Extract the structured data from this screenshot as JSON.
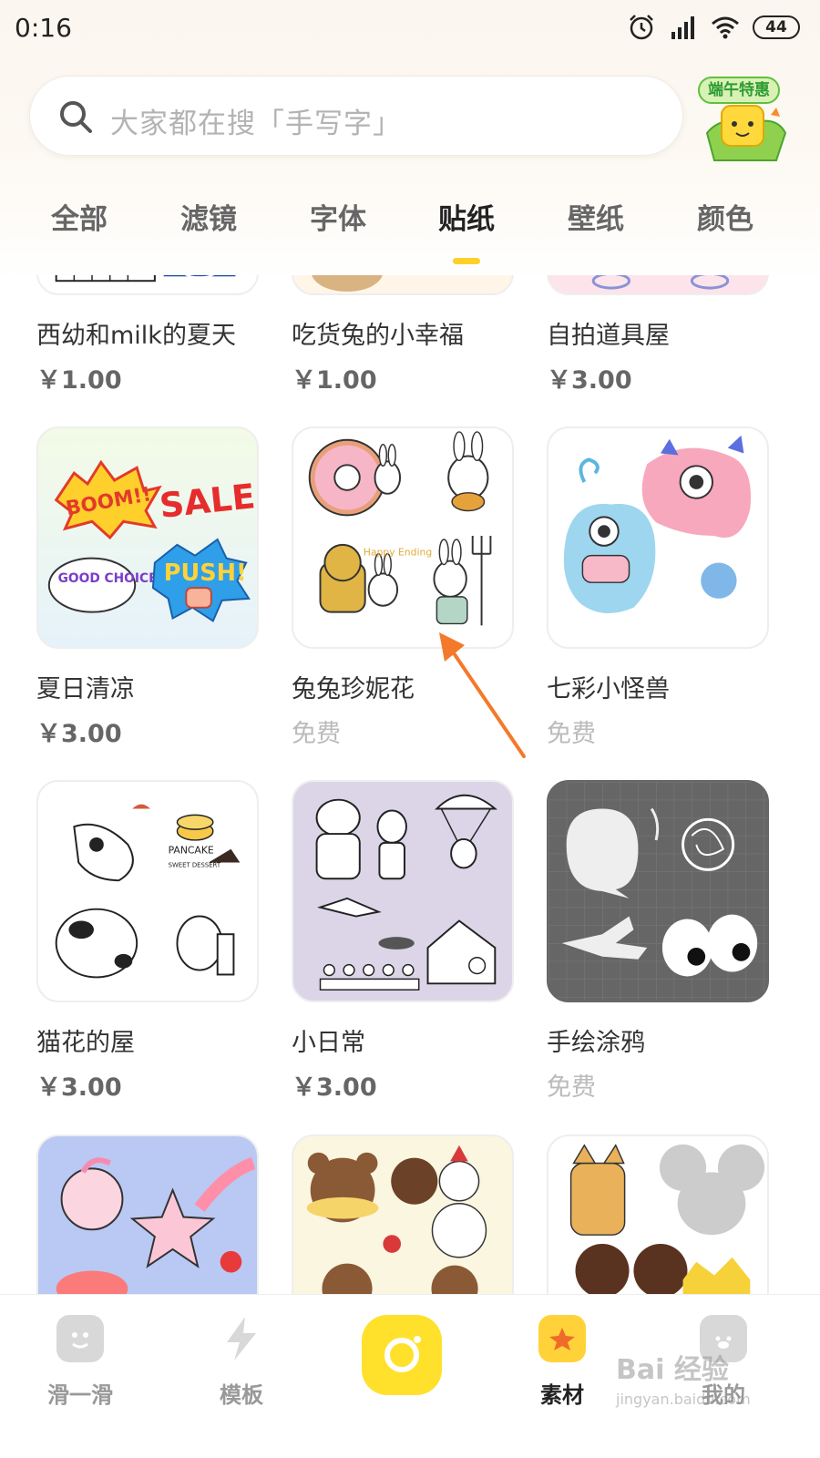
{
  "status_bar": {
    "time": "0:16",
    "battery": "44"
  },
  "search": {
    "placeholder": "大家都在搜「手写字」"
  },
  "promo": {
    "label": "端午特惠"
  },
  "tabs": [
    {
      "label": "全部"
    },
    {
      "label": "滤镜"
    },
    {
      "label": "字体"
    },
    {
      "label": "贴纸",
      "active": true
    },
    {
      "label": "壁纸"
    },
    {
      "label": "颜色"
    }
  ],
  "items": [
    {
      "title": "西幼和milk的夏天",
      "price": "￥1.00"
    },
    {
      "title": "吃货兔的小幸福",
      "price": "￥1.00"
    },
    {
      "title": "自拍道具屋",
      "price": "￥3.00"
    },
    {
      "title": "夏日清凉",
      "price": "￥3.00"
    },
    {
      "title": "兔兔珍妮花",
      "price": "免费"
    },
    {
      "title": "七彩小怪兽",
      "price": "免费"
    },
    {
      "title": "猫花的屋",
      "price": "￥3.00"
    },
    {
      "title": "小日常",
      "price": "￥3.00"
    },
    {
      "title": "手绘涂鸦",
      "price": "免费"
    }
  ],
  "sticker_text": {
    "boom": "BOOM!!",
    "sale": "SALE",
    "good_choice": "GOOD CHOICE",
    "push": "PUSH!",
    "happy_ending": "Happy Ending",
    "pancake": "PANCAKE",
    "sweet": "SWEET DESSERT"
  },
  "bottom_nav": [
    {
      "label": "滑一滑"
    },
    {
      "label": "模板"
    },
    {
      "label": "素材",
      "active": true
    },
    {
      "label": "我的"
    }
  ],
  "watermark": {
    "main": "Bai 经验",
    "sub": "jingyan.baidu.com"
  },
  "colors": {
    "accent": "#ffd02a",
    "camera": "#ffe12b",
    "arrow": "#f4792a"
  }
}
